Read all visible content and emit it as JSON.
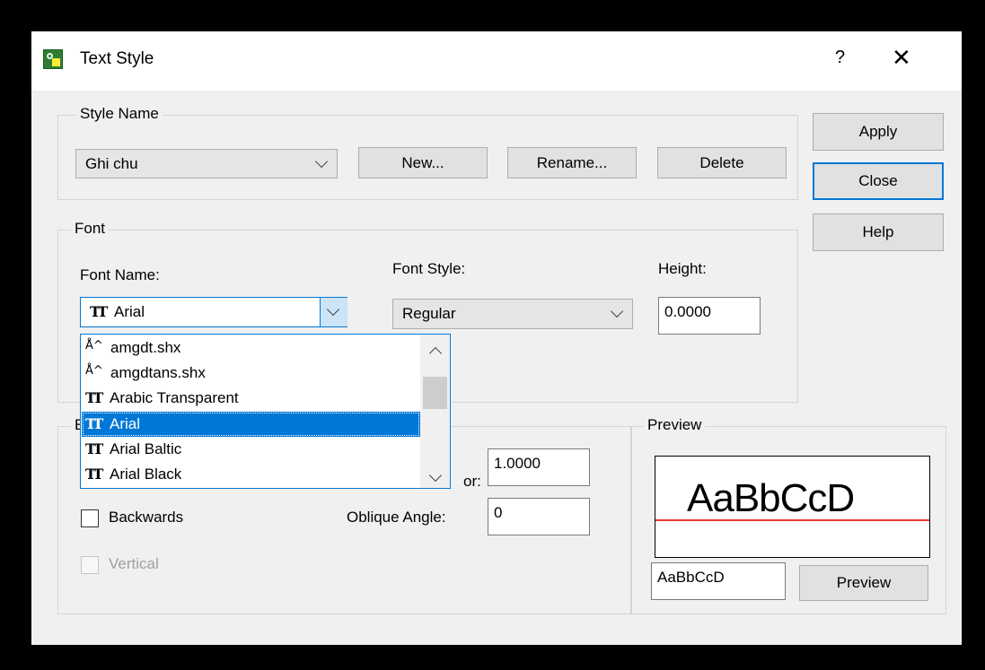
{
  "window": {
    "title": "Text Style",
    "help_glyph": "?",
    "close_glyph": "✕"
  },
  "style_name": {
    "group_label": "Style Name",
    "selected": "Ghi chu",
    "new_button": "New...",
    "rename_button": "Rename...",
    "delete_button": "Delete"
  },
  "side_buttons": {
    "apply": "Apply",
    "close": "Close",
    "help": "Help"
  },
  "font": {
    "group_label": "Font",
    "font_name_label": "Font Name:",
    "font_name_value": "Arial",
    "font_style_label": "Font Style:",
    "font_style_value": "Regular",
    "height_label": "Height:",
    "height_value": "0.0000"
  },
  "font_dropdown": {
    "items": [
      {
        "label": "amgdt.shx",
        "icon": "shx-font-icon"
      },
      {
        "label": "amgdtans.shx",
        "icon": "shx-font-icon"
      },
      {
        "label": "Arabic Transparent",
        "icon": "truetype-font-icon"
      },
      {
        "label": "Arial",
        "icon": "truetype-font-icon",
        "selected": true
      },
      {
        "label": "Arial Baltic",
        "icon": "truetype-font-icon"
      },
      {
        "label": "Arial Black",
        "icon": "truetype-font-icon"
      }
    ]
  },
  "effects": {
    "group_label_visible": "E",
    "width_factor_label_visible": "or:",
    "width_factor_value": "1.0000",
    "backwards_label": "Backwards",
    "backwards_checked": false,
    "oblique_label": "Oblique Angle:",
    "oblique_value": "0",
    "vertical_label": "Vertical",
    "vertical_enabled": false
  },
  "preview": {
    "group_label": "Preview",
    "sample_text": "AaBbCcD",
    "input_value": "AaBbCcD",
    "button": "Preview",
    "baseline_color": "#e53935"
  },
  "colors": {
    "accent": "#0078d7",
    "dialog_bg": "#f0f0f0"
  }
}
